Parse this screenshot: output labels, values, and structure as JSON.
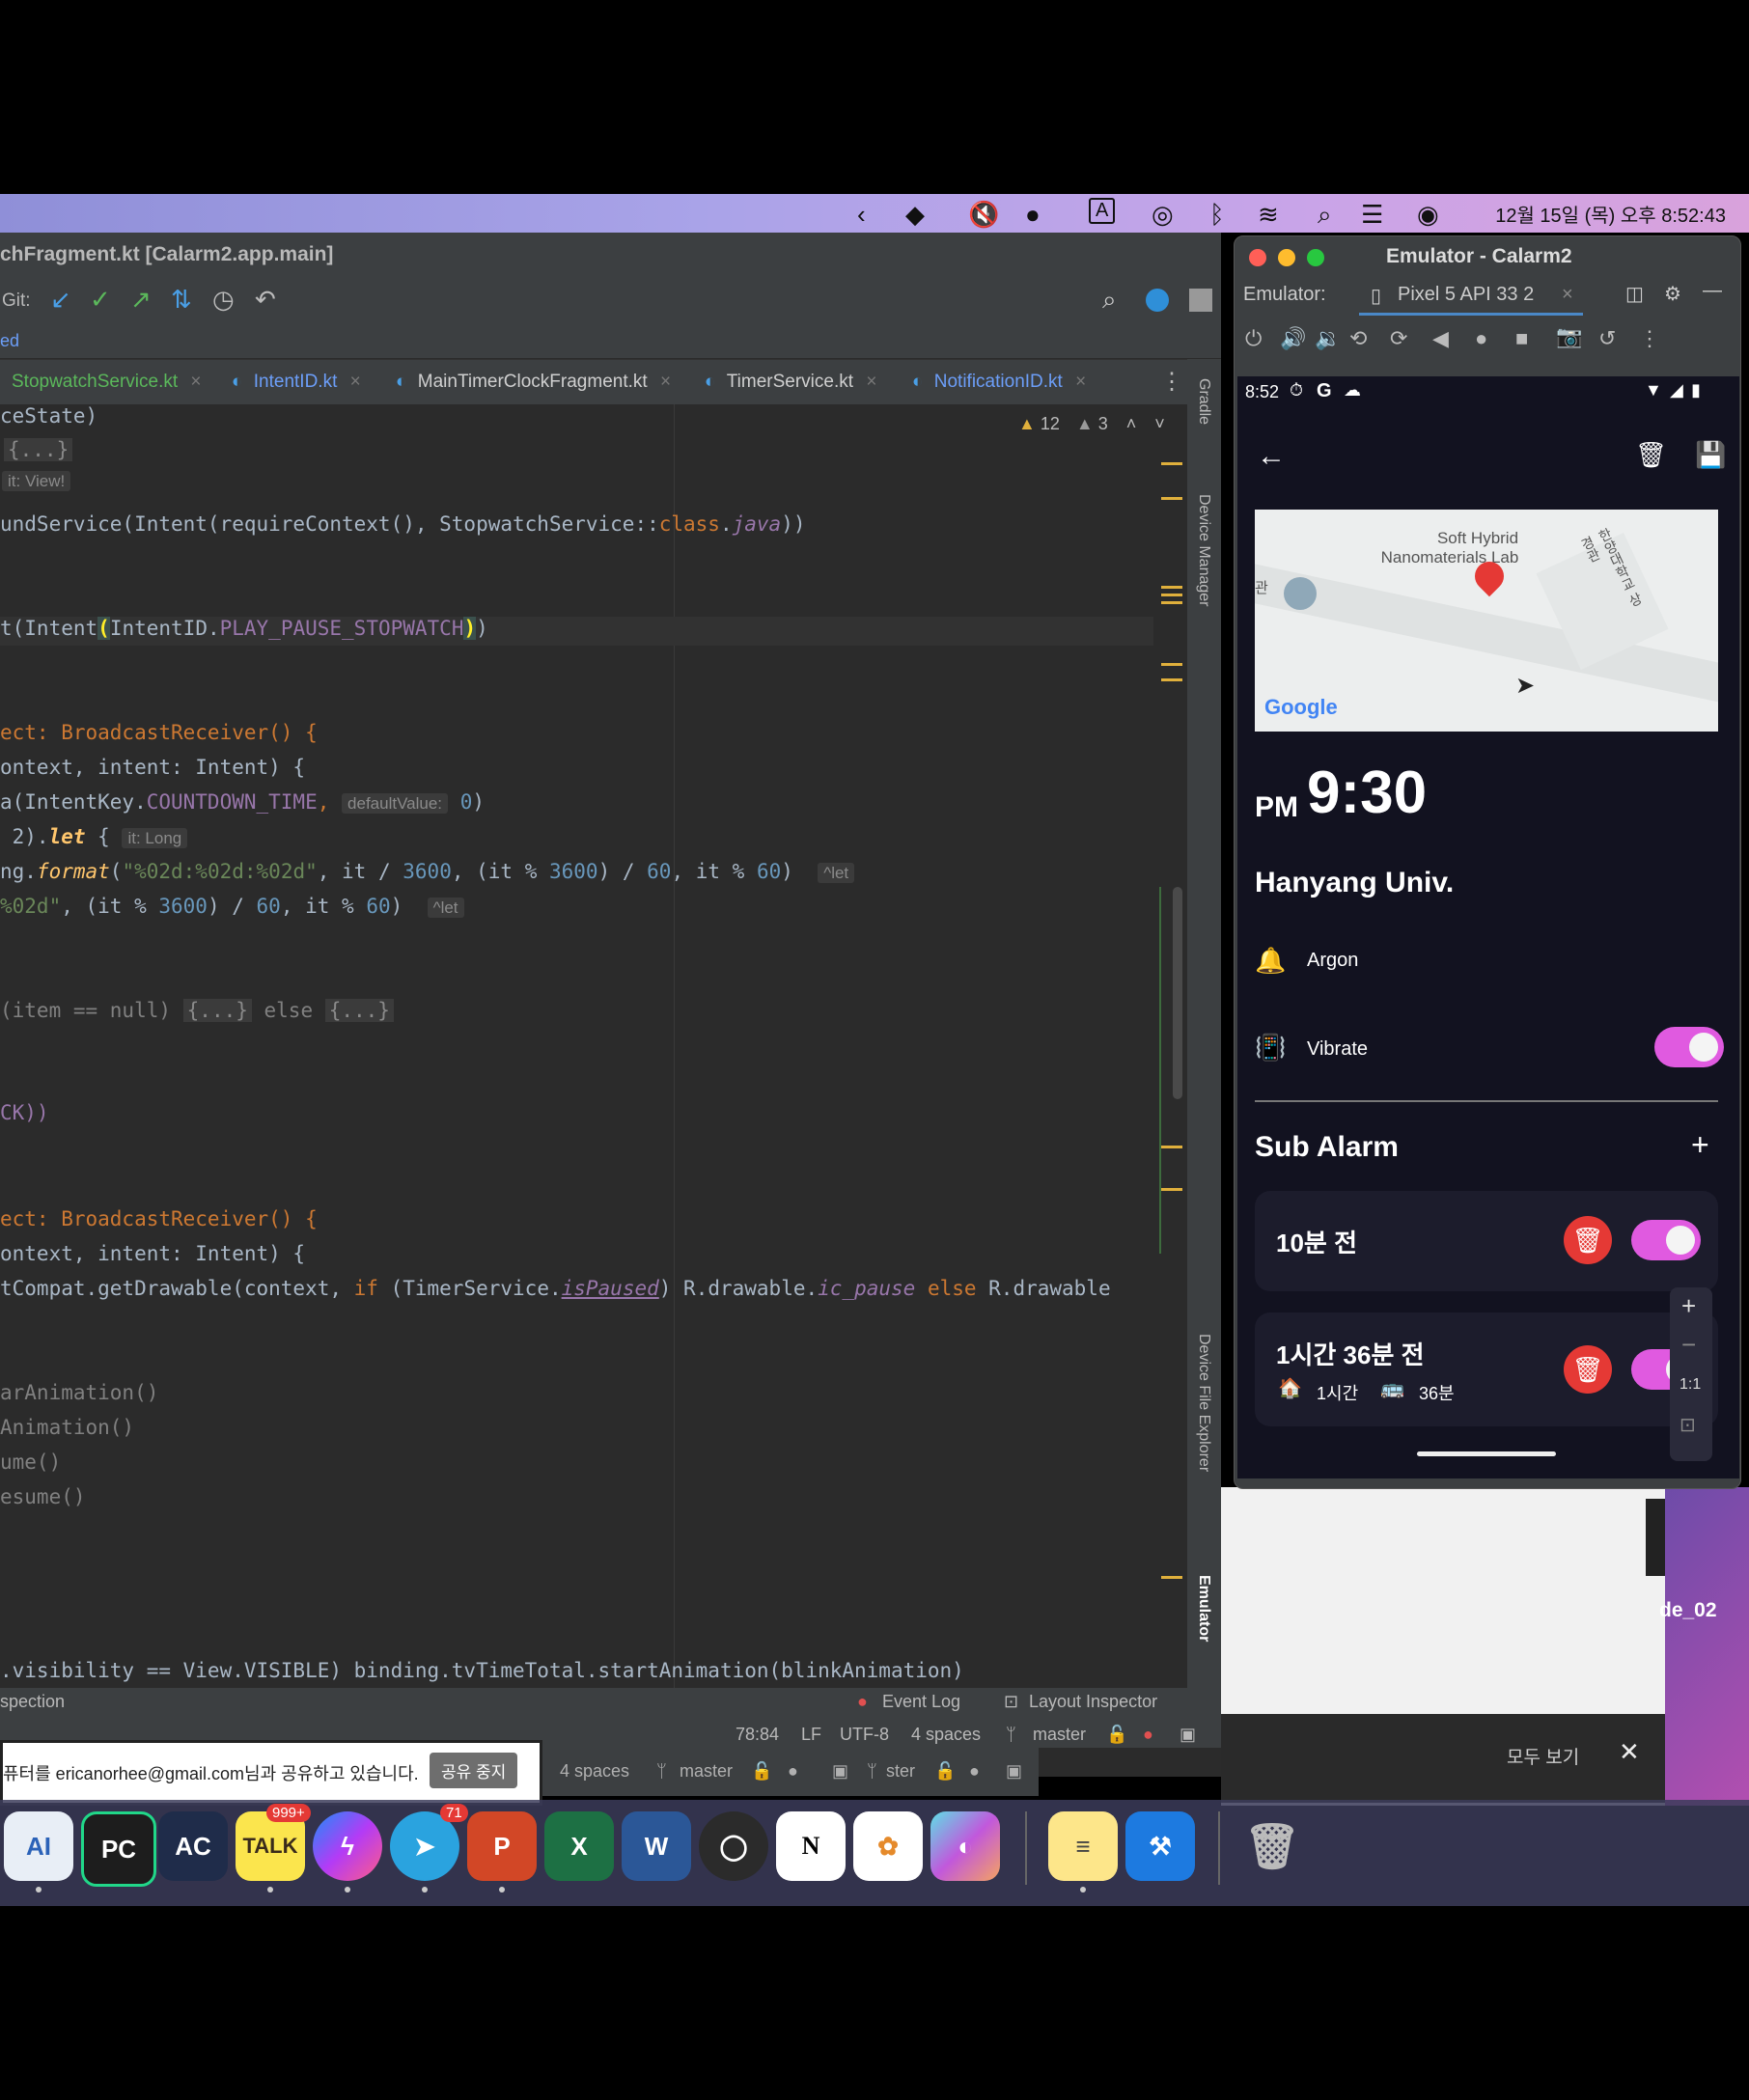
{
  "menubar": {
    "clock": "12월 15일 (목) 오후 8:52:43",
    "input_indicator": "A"
  },
  "ide": {
    "title": "chFragment.kt [Calarm2.app.main]",
    "git_label": "Git:",
    "sub_label": "ed",
    "tabs": [
      "StopwatchService.kt",
      "IntentID.kt",
      "MainTimerClockFragment.kt",
      "TimerService.kt",
      "NotificationID.kt"
    ],
    "warnings": "12",
    "weak_warnings": "3",
    "code": {
      "l1": "ceState)",
      "l2_fold": "{...}",
      "l3_hint": "it: View!",
      "l4a": "undService(Intent(requireContext(), StopwatchService::",
      "l4b": "class",
      "l4c": ".",
      "l4d": "java",
      "l4e": "))",
      "l5a": "t(Intent",
      "l5b": "(",
      "l5c": "IntentID.",
      "l5d": "PLAY_PAUSE_STOPWATCH",
      "l5e": ")",
      "l5f": ")",
      "l6a": "ect: BroadcastReceiver() {",
      "l7a": "ontext, intent: Intent) {",
      "l8a": "a(IntentKey.",
      "l8b": "COUNTDOWN_TIME",
      "l8c": ",",
      "l8hint": "defaultValue:",
      "l8d": "0",
      "l8e": ")",
      "l9a": " 2).",
      "l9b": "let",
      "l9c": " {",
      "l9hint": "it: Long",
      "l10a": "ng.",
      "l10b": "format",
      "l10c": "(",
      "l10d": "\"%02d:%02d:%02d\"",
      "l10e": ", it / ",
      "l10f": "3600",
      "l10g": ", (it % ",
      "l10h": "3600",
      "l10i": ") / ",
      "l10j": "60",
      "l10k": ", it % ",
      "l10l": "60",
      "l10m": ")",
      "l10hint": "^let",
      "l11a": "%02d\"",
      "l11b": ", (it % ",
      "l11c": "3600",
      "l11d": ") / ",
      "l11e": "60",
      "l11f": ", it % ",
      "l11g": "60",
      "l11h": ")",
      "l11hint": "^let",
      "l12a": "(item == null) ",
      "l12fold1": "{...}",
      "l12b": " else ",
      "l12fold2": "{...}",
      "l13a": "CK))",
      "l14a": "ect: BroadcastReceiver() {",
      "l15a": "ontext, intent: Intent) {",
      "l16a": "tCompat.getDrawable(context, ",
      "l16b": "if",
      "l16c": " (TimerService.",
      "l16d": "isPaused",
      "l16e": ") R.drawable.",
      "l16f": "ic_pause",
      "l16g": " else ",
      "l16h": "R.drawable",
      "l17a": "arAnimation()",
      "l18a": "Animation()",
      "l19a": "ume()",
      "l20a": "esume()",
      "l21a": ".visibility == View.VISIBLE) binding.tvTimeTotal.startAnimation(blinkAnimation)"
    },
    "side_gradle": "Gradle",
    "side_device_manager": "Device Manager",
    "side_file_explorer": "Device File Explorer",
    "side_emulator": "Emulator",
    "status": {
      "inspection": "spection",
      "event_log": "Event Log",
      "layout_inspector": "Layout Inspector",
      "position": "78:84",
      "line_sep": "LF",
      "encoding": "UTF-8",
      "indent": "4 spaces",
      "branch": "master"
    },
    "status2": {
      "indent": "4 spaces",
      "branch": "master",
      "branch2": "ster"
    }
  },
  "emulator": {
    "title": "Emulator - Calarm2",
    "label": "Emulator:",
    "device": "Pixel 5 API 33 2",
    "phone": {
      "time": "8:52",
      "map_place1": "Soft Hybrid",
      "map_place2": "Nanomaterials Lab",
      "map_side_left": "관",
      "map_side_right": "한양대학교 상경관",
      "map_logo": "Google",
      "ampm": "PM",
      "alarm_time": "9:30",
      "location": "Hanyang Univ.",
      "ringtone": "Argon",
      "vibrate_label": "Vibrate",
      "sub_alarm_title": "Sub Alarm",
      "sub_alarms": [
        {
          "title": "10분 전"
        },
        {
          "title": "1시간 36분 전",
          "walk": "1시간",
          "bus": "36분"
        }
      ],
      "zoom_ratio": "1:1"
    }
  },
  "share": {
    "message": "퓨터를 ericanorhee@gmail.com님과 공유하고 있습니다.",
    "stop_button": "공유 중지"
  },
  "finder": {
    "file_label": "de_02",
    "see_all": "모두 보기"
  },
  "dock": {
    "talk_badge": "999+",
    "telegram_badge": "71"
  }
}
